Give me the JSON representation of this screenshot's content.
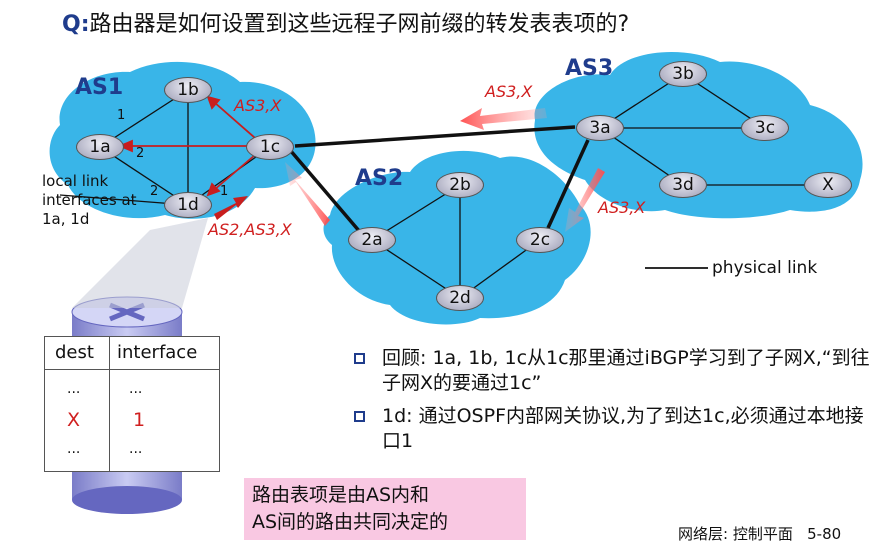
{
  "title": {
    "prefix": "Q:",
    "text": "路由器是如何设置到这些远程子网前缀的转发表表项的?"
  },
  "as_labels": {
    "as1": "AS1",
    "as2": "AS2",
    "as3": "AS3"
  },
  "routers": {
    "r1a": "1a",
    "r1b": "1b",
    "r1c": "1c",
    "r1d": "1d",
    "r2a": "2a",
    "r2b": "2b",
    "r2c": "2c",
    "r2d": "2d",
    "r3a": "3a",
    "r3b": "3b",
    "r3c": "3c",
    "r3d": "3d",
    "rx": "X"
  },
  "interface_numbers": {
    "n1_top": "1",
    "n2_upper": "2",
    "n2_lower": "2",
    "n1_right": "1"
  },
  "route_labels": {
    "as3x_in_as1": "AS3,X",
    "as3x_to_as1": "AS3,X",
    "as3x_to_as2": "AS3,X",
    "as2as3x": "AS2,AS3,X"
  },
  "local_link_text": "local link interfaces at 1a, 1d",
  "legend": {
    "physical_link": "physical link"
  },
  "table": {
    "headers": [
      "dest",
      "interface"
    ],
    "rows": [
      [
        "...",
        "..."
      ],
      [
        "X",
        "1"
      ],
      [
        "...",
        "..."
      ]
    ]
  },
  "bullets": [
    "回顾: 1a, 1b, 1c从1c那里通过iBGP学习到了子网X,“到往子网X的要通过1c”",
    "1d: 通过OSPF内部网关协议,为了到达1c,必须通过本地接口1"
  ],
  "note": {
    "line1": "路由表项是由AS内和",
    "line2": "AS间的路由共同决定的"
  },
  "footer": {
    "text": "网络层: 控制平面",
    "page": "5-80"
  },
  "colors": {
    "cloud": "#39b5e8",
    "title_blue": "#1f3c8c",
    "red": "#d01f1f",
    "pink": "#f9c8e2"
  }
}
